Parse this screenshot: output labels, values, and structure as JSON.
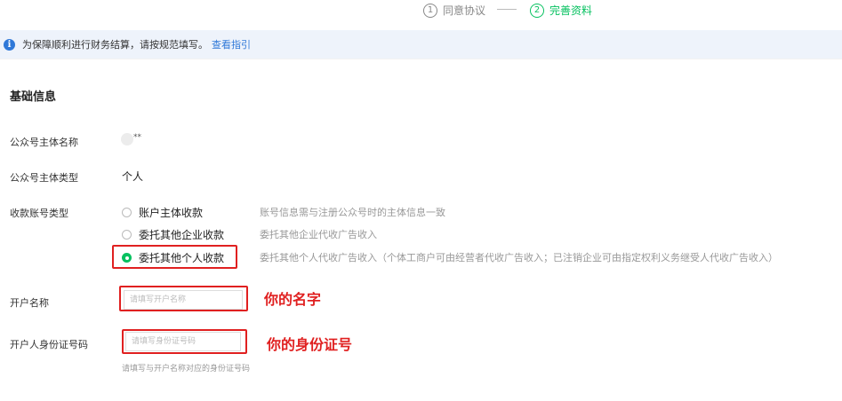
{
  "steps": [
    {
      "num": "1",
      "label": "同意协议"
    },
    {
      "num": "2",
      "label": "完善资料"
    }
  ],
  "notice": {
    "icon": "info-icon",
    "text": "为保障顺利进行财务结算，请按规范填写。",
    "link": "查看指引"
  },
  "section": {
    "title": "基础信息"
  },
  "fields": {
    "subject_name": {
      "label": "公众号主体名称",
      "value": "**"
    },
    "subject_type": {
      "label": "公众号主体类型",
      "value": "个人"
    },
    "account_type": {
      "label": "收款账号类型",
      "options": [
        {
          "label": "账户主体收款",
          "desc": "账号信息需与注册公众号时的主体信息一致",
          "checked": false
        },
        {
          "label": "委托其他企业收款",
          "desc": "委托其他企业代收广告收入",
          "checked": false
        },
        {
          "label": "委托其他个人收款",
          "desc": "委托其他个人代收广告收入（个体工商户可由经营者代收广告收入；已注销企业可由指定权利义务继受人代收广告收入）",
          "checked": true
        }
      ]
    },
    "account_name": {
      "label": "开户名称",
      "placeholder": "请填写开户名称",
      "annotation": "你的名字"
    },
    "id_number": {
      "label": "开户人身份证号码",
      "placeholder": "请填写身份证号码",
      "annotation": "你的身份证号",
      "hint": "请填写与开户名称对应的身份证号码"
    }
  },
  "colors": {
    "accent": "#07c160",
    "link": "#2f78d8",
    "highlight": "#e02020"
  }
}
